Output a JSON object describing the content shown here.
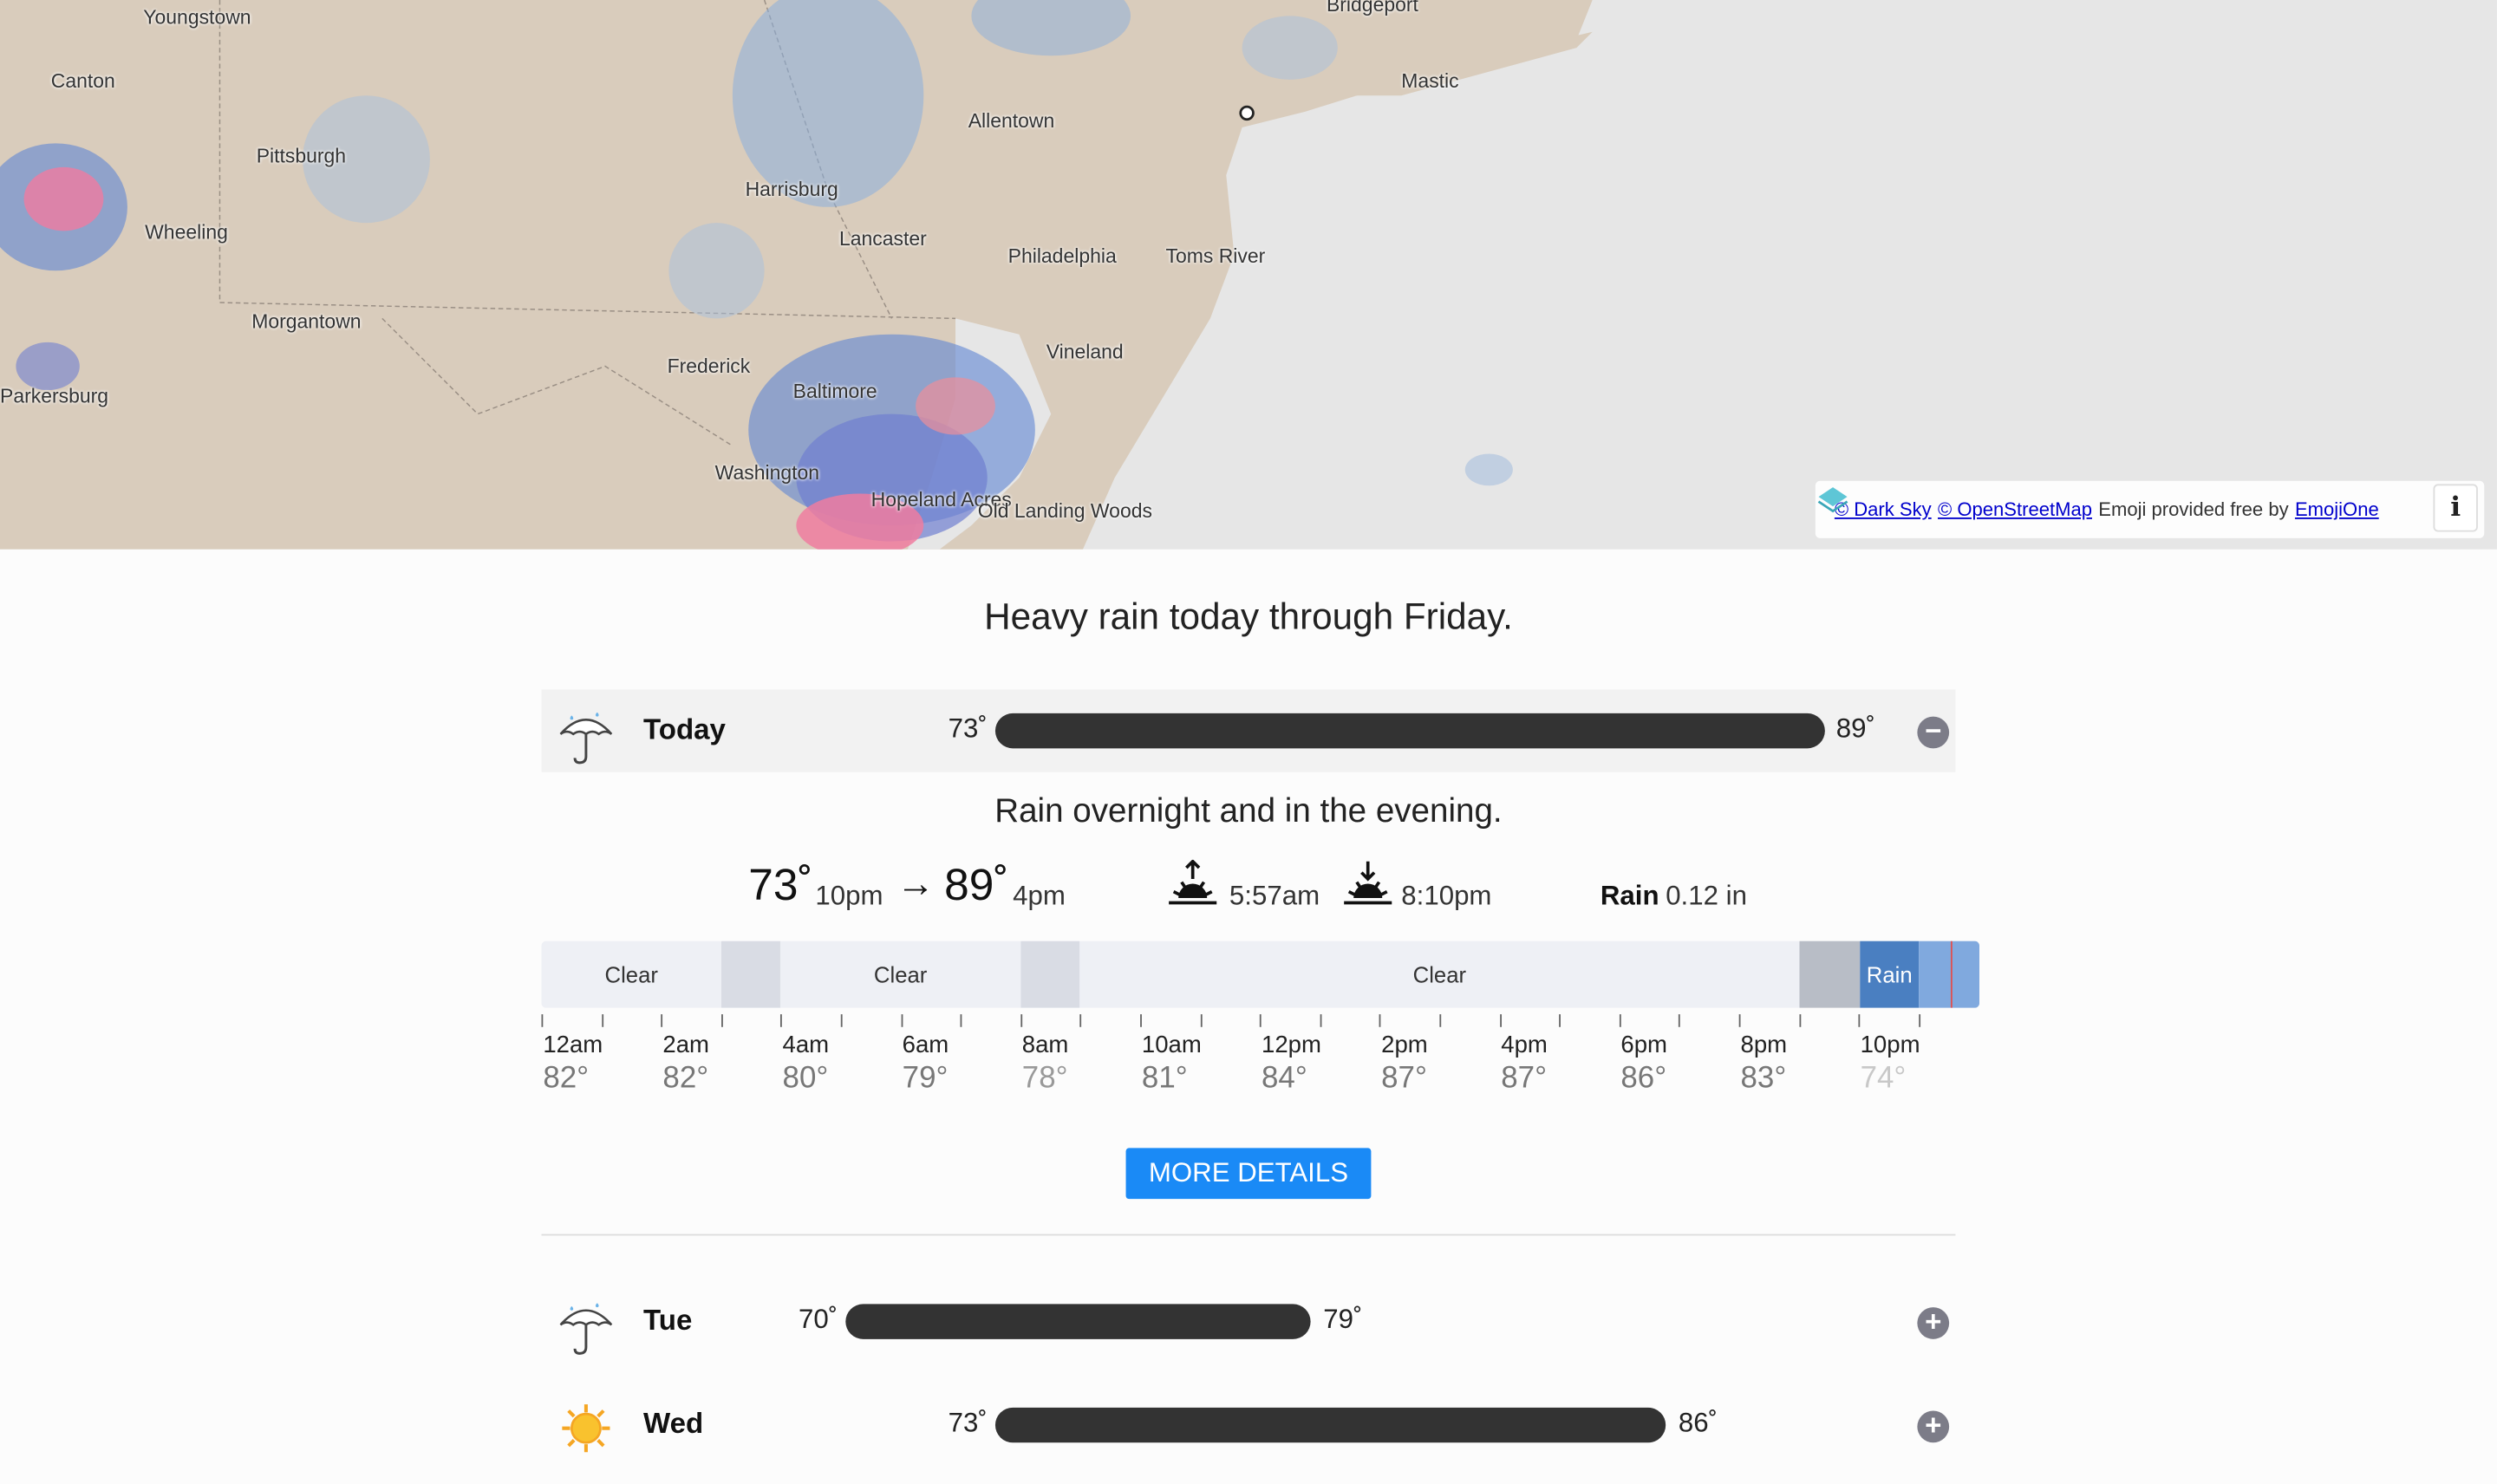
{
  "map": {
    "labels": [
      {
        "text": "Youngstown"
      },
      {
        "text": "Canton"
      },
      {
        "text": "Pittsburgh"
      },
      {
        "text": "Wheeling"
      },
      {
        "text": "Morgantown"
      },
      {
        "text": "Parkersburg"
      },
      {
        "text": "Harrisburg"
      },
      {
        "text": "Lancaster"
      },
      {
        "text": "Allentown"
      },
      {
        "text": "Bridgeport"
      },
      {
        "text": "Mastic"
      },
      {
        "text": "Philadelphia"
      },
      {
        "text": "Toms River"
      },
      {
        "text": "Vineland"
      },
      {
        "text": "Frederick"
      },
      {
        "text": "Baltimore"
      },
      {
        "text": "Washington"
      },
      {
        "text": "Hopeland Acres"
      },
      {
        "text": "Old Landing Woods"
      }
    ],
    "attribution": {
      "darksky": "© Dark Sky",
      "osm": "© OpenStreetMap",
      "emoji_text": "Emoji provided free by",
      "emojione": "EmojiOne",
      "info": "i"
    }
  },
  "summary": "Heavy rain today through Friday.",
  "today": {
    "name": "Today",
    "icon": "umbrella-rain-icon",
    "min": "73˚",
    "max": "89˚",
    "toggle": "−",
    "description": "Rain overnight and in the evening.",
    "low_temp": "73˚",
    "low_time": "10pm",
    "arrow": "→",
    "high_temp": "89˚",
    "high_time": "4pm",
    "sunrise": "5:57am",
    "sunset": "8:10pm",
    "rain_label": "Rain",
    "rain_value": "0.12 in",
    "segments": [
      {
        "label": "Clear",
        "color": "#eef0f5"
      },
      {
        "label": "",
        "color": "#d9dce4"
      },
      {
        "label": "Clear",
        "color": "#eef0f5"
      },
      {
        "label": "",
        "color": "#d9dce4"
      },
      {
        "label": "Clear",
        "color": "#eef0f5"
      },
      {
        "label": "",
        "color": "#b8bdc6"
      },
      {
        "label": "Rain",
        "color": "#4a7fc1"
      },
      {
        "label": "",
        "color": "#80a9de"
      }
    ],
    "hours": [
      {
        "time": "12am",
        "temp": "82°"
      },
      {
        "time": "2am",
        "temp": "82°"
      },
      {
        "time": "4am",
        "temp": "80°"
      },
      {
        "time": "6am",
        "temp": "79°"
      },
      {
        "time": "8am",
        "temp": "78°"
      },
      {
        "time": "10am",
        "temp": "81°"
      },
      {
        "time": "12pm",
        "temp": "84°"
      },
      {
        "time": "2pm",
        "temp": "87°"
      },
      {
        "time": "4pm",
        "temp": "87°"
      },
      {
        "time": "6pm",
        "temp": "86°"
      },
      {
        "time": "8pm",
        "temp": "83°"
      },
      {
        "time": "10pm",
        "temp": "74°"
      }
    ]
  },
  "more_details": "MORE DETAILS",
  "days": [
    {
      "name": "Tue",
      "icon": "umbrella-rain-icon",
      "min": "70˚",
      "max": "79˚",
      "toggle": "+"
    },
    {
      "name": "Wed",
      "icon": "sun-icon",
      "min": "73˚",
      "max": "86˚",
      "toggle": "+"
    }
  ],
  "colors": {
    "accent": "#1a8af6",
    "bar": "#333333",
    "rain": "#4a7fc1"
  }
}
